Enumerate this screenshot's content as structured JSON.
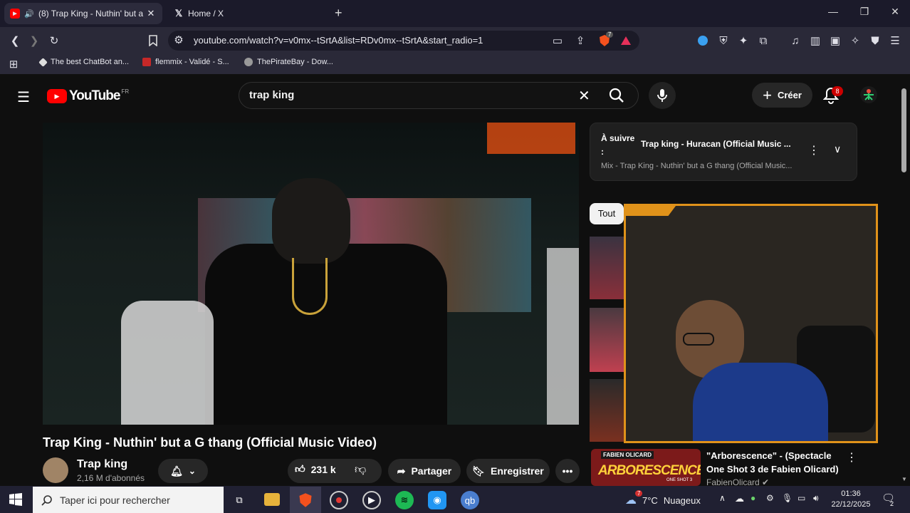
{
  "browser": {
    "tabs": [
      {
        "title": "(8) Trap King - Nuthin' but a G",
        "icon": "youtube-icon"
      },
      {
        "title": "Home / X",
        "icon": "x-icon"
      }
    ],
    "url": "youtube.com/watch?v=v0mx--tSrtA&list=RDv0mx--tSrtA&start_radio=1",
    "shield_count": "7",
    "bookmarks": [
      {
        "label": "The best ChatBot an..."
      },
      {
        "label": "flemmix - Validé - S..."
      },
      {
        "label": "ThePirateBay - Dow..."
      }
    ]
  },
  "youtube": {
    "logo_text": "YouTube",
    "logo_region": "FR",
    "search_value": "trap king",
    "create_label": "Créer",
    "notification_count": "8",
    "video_title": "Trap King - Nuthin' but a G thang (Official Music Video)",
    "channel_name": "Trap king",
    "subscribers": "2,16 M d'abonnés",
    "like_count": "231 k",
    "share_label": "Partager",
    "save_label": "Enregistrer",
    "up_next_label": "À suivre :",
    "up_next_title": "Trap king - Huracan (Official Music ...",
    "up_next_sub": "Mix - Trap King - Nuthin' but a G thang (Official Music...",
    "chip_all": "Tout",
    "rec_title": "\"Arborescence\" - (Spectacle One Shot 3 de Fabien Olicard)",
    "rec_channel": "FabienOlicard",
    "rec_thumb_top": "FABIEN OLICARD",
    "rec_thumb_main": "ARBORESCENCE",
    "rec_thumb_badge": "ONE SHOT 3"
  },
  "taskbar": {
    "search_placeholder": "Taper ici pour rechercher",
    "temperature": "7°C",
    "weather": "Nuageux",
    "weather_badge": "7",
    "time": "01:36",
    "date": "22/12/2025",
    "notification_count": "2"
  },
  "colors": {
    "accent": "#ff0000",
    "cam_border": "#e0921a",
    "taskbar": "#202032"
  }
}
